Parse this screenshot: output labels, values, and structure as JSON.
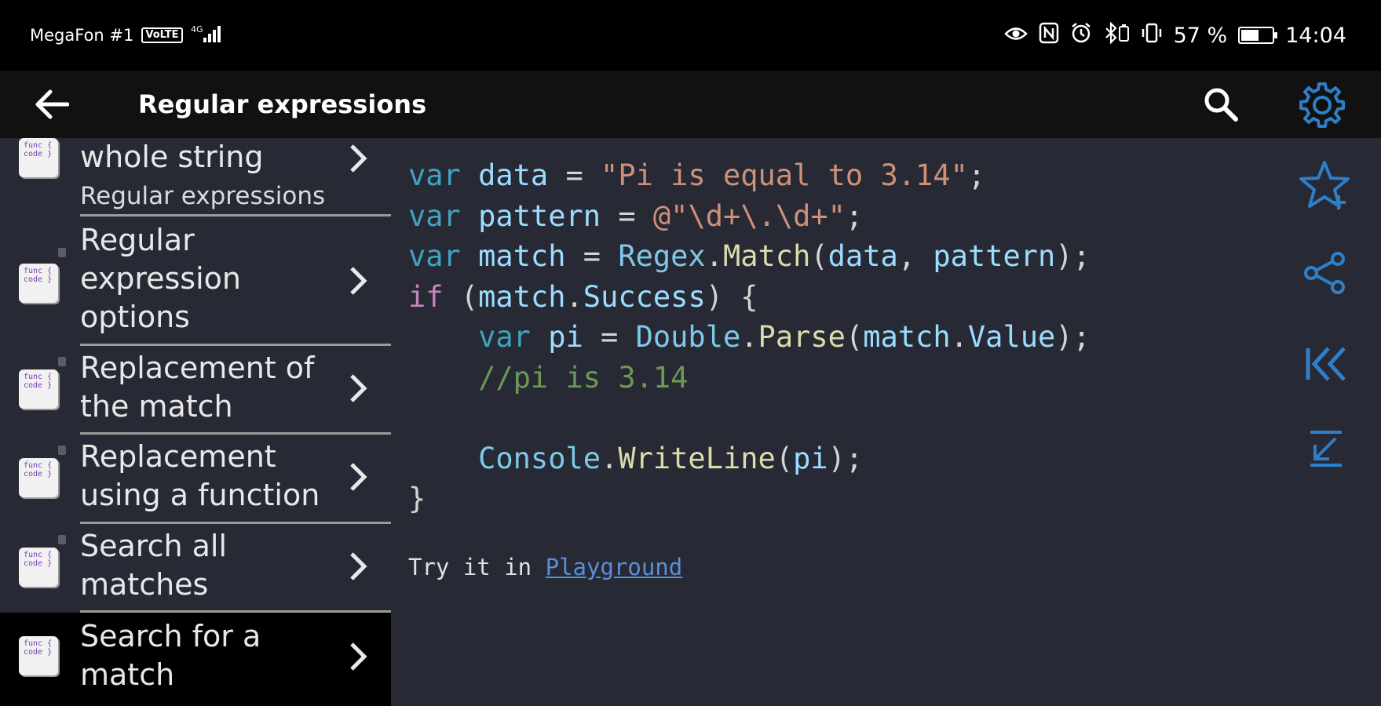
{
  "status_bar": {
    "carrier": "MegaFon #1",
    "volte": "VoLTE",
    "network": "4G",
    "battery_percent": "57 %",
    "battery_level": 0.57,
    "time": "14:04",
    "icons": [
      "eye-icon",
      "nfc-icon",
      "alarm-icon",
      "bluetooth-icon",
      "vibrate-icon"
    ]
  },
  "toolbar": {
    "title": "Regular expressions",
    "back_icon": "arrow-left-icon",
    "search_icon": "search-icon",
    "settings_icon": "gear-icon",
    "accent_color": "#2f7fc8"
  },
  "sidebar": {
    "thumb_text": "func { code }",
    "items": [
      {
        "label": "whole string",
        "subtitle": "Regular expressions",
        "locked": false,
        "active": false
      },
      {
        "label": "Regular expression options",
        "locked": true,
        "active": false
      },
      {
        "label": "Replacement of the match",
        "locked": true,
        "active": false
      },
      {
        "label": "Replacement using a function",
        "locked": true,
        "active": false
      },
      {
        "label": "Search all matches",
        "locked": true,
        "active": false
      },
      {
        "label": "Search for a match",
        "locked": false,
        "active": true
      }
    ]
  },
  "code": {
    "lines": [
      "var data = \"Pi is equal to 3.14\";",
      "var pattern = @\"\\d+\\.\\d+\";",
      "var match = Regex.Match(data, pattern);",
      "if (match.Success) {",
      "    var pi = Double.Parse(match.Value);",
      "    //pi is 3.14",
      "",
      "    Console.WriteLine(pi);",
      "}"
    ],
    "try_prefix": "Try it in ",
    "try_link": "Playground"
  },
  "actions": [
    "star-add-icon",
    "share-icon",
    "first-page-icon",
    "scroll-bottom-icon"
  ]
}
